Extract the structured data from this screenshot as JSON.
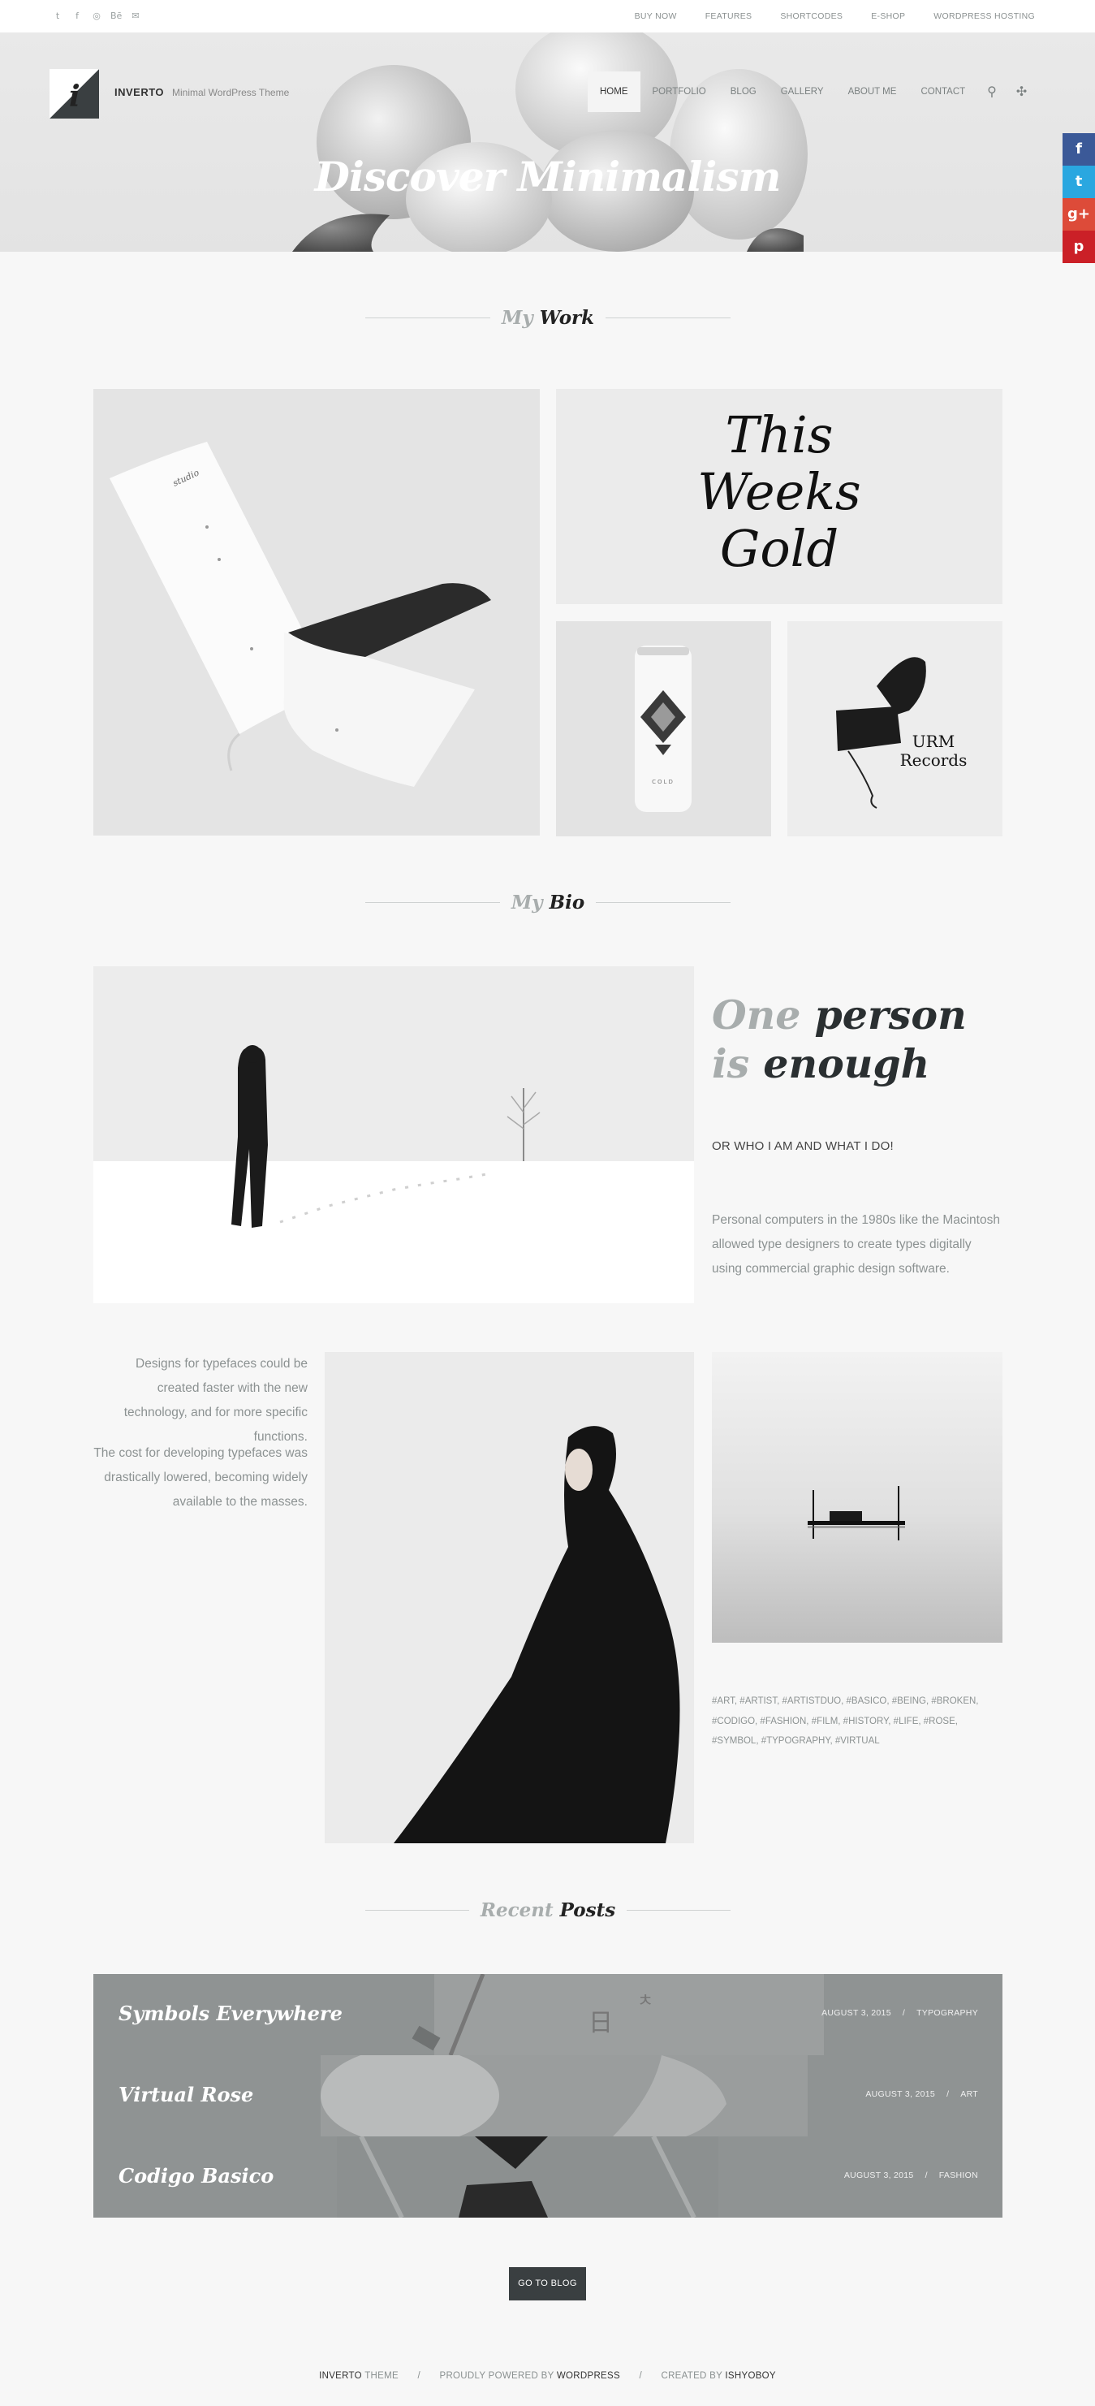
{
  "topbar": {
    "social_icons": [
      "twitter-icon",
      "facebook-icon",
      "dribbble-icon",
      "behance-icon",
      "email-icon"
    ],
    "social_glyphs": [
      "t",
      "f",
      "◎",
      "Bē",
      "✉"
    ],
    "nav": [
      "BUY NOW",
      "FEATURES",
      "SHORTCODES",
      "E-SHOP",
      "WORDPRESS HOSTING"
    ]
  },
  "header": {
    "logo_letter": "i",
    "logo_text": "INVERTO",
    "tagline": "Minimal WordPress Theme",
    "nav": [
      "HOME",
      "PORTFOLIO",
      "BLOG",
      "GALLERY",
      "ABOUT ME",
      "CONTACT"
    ],
    "active_nav": "HOME",
    "search_glyph": "⚲",
    "plus_glyph": "✣"
  },
  "hero": {
    "title": "Discover Minimalism"
  },
  "share": {
    "items": [
      {
        "name": "facebook",
        "glyph": "f",
        "color": "#3b5998"
      },
      {
        "name": "twitter",
        "glyph": "t",
        "color": "#2aa7e0"
      },
      {
        "name": "google-plus",
        "glyph": "g+",
        "color": "#dd4b39"
      },
      {
        "name": "pinterest",
        "glyph": "p",
        "color": "#cb2027"
      }
    ]
  },
  "work": {
    "heading_muted": "My",
    "heading": "Work",
    "gold_text": [
      "This",
      "Weeks",
      "Gold"
    ],
    "can_label": "COLD",
    "records_text": [
      "URM",
      "Records"
    ]
  },
  "bio": {
    "heading_muted": "My",
    "heading": "Bio",
    "headline_line1_muted": "One",
    "headline_line1": "person",
    "headline_line2_muted": "is",
    "headline_line2": "enough",
    "subheading": "OR WHO I AM AND WHAT I DO!",
    "paragraph_right": "Personal computers in the 1980s like the Macintosh allowed type designers to create types digitally using commercial graphic design software.",
    "paragraph_left_1": "Designs for typefaces could be created faster with the new technology, and for more specific functions.",
    "paragraph_left_2": "The cost for developing typefaces was drastically lowered, becoming widely available to the masses.",
    "tags": "#ART, #ARTIST, #ARTISTDUO, #BASICO, #BEING, #BROKEN, #CODIGO, #FASHION, #FILM, #HISTORY, #LIFE, #ROSE, #SYMBOL, #TYPOGRAPHY, #VIRTUAL"
  },
  "posts": {
    "heading_muted": "Recent",
    "heading": "Posts",
    "items": [
      {
        "title": "Symbols Everywhere",
        "date": "AUGUST 3, 2015",
        "category": "TYPOGRAPHY"
      },
      {
        "title": "Virtual Rose",
        "date": "AUGUST 3, 2015",
        "category": "ART"
      },
      {
        "title": "Codigo Basico",
        "date": "AUGUST 3, 2015",
        "category": "FASHION"
      }
    ],
    "separator": "/",
    "button": "GO TO BLOG"
  },
  "footer": {
    "brand": "INVERTO",
    "brand_suffix": "THEME",
    "powered_prefix": "PROUDLY POWERED BY",
    "powered": "WORDPRESS",
    "created_prefix": "CREATED BY",
    "creator": "ISHYOBOY",
    "separator": "/"
  }
}
